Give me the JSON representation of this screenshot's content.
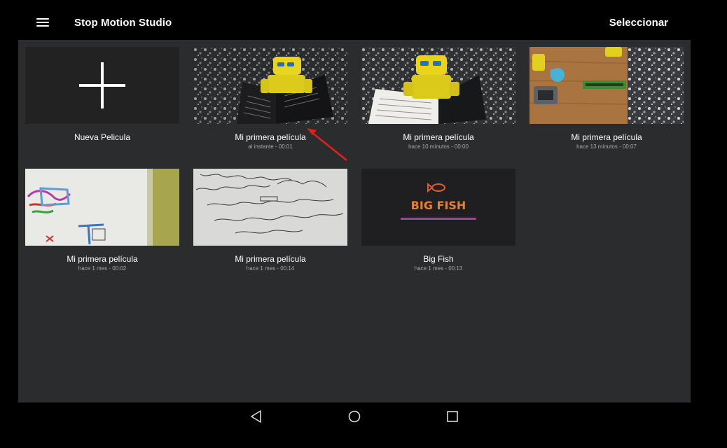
{
  "app_bar": {
    "title": "Stop Motion Studio",
    "select_label": "Seleccionar",
    "menu_icon": "hamburger-menu-icon"
  },
  "new_movie": {
    "label": "Nueva Pelicula",
    "icon": "plus-icon"
  },
  "movies": [
    {
      "title": "Mi primera película",
      "meta": "al instante - 00:01",
      "thumb": "yellow robot reading book"
    },
    {
      "title": "Mi primera película",
      "meta": "hace 10 minutos - 00:00",
      "thumb": "yellow robot reading book"
    },
    {
      "title": "Mi primera película",
      "meta": "hace 13 minutos - 00:07",
      "thumb": "toys on wooden table"
    },
    {
      "title": "Mi primera película",
      "meta": "hace 1 mes - 00:02",
      "thumb": "child drawing"
    },
    {
      "title": "Mi primera película",
      "meta": "hace 1 mes - 00:14",
      "thumb": "pencil sketch of clouds"
    },
    {
      "title": "Big Fish",
      "meta": "hace 1 mes - 00:13",
      "thumb": "big fish title card"
    }
  ],
  "thumb_text": {
    "big_fish_title": "BIG FISH"
  },
  "nav_bar": {
    "back_icon": "back-triangle-icon",
    "home_icon": "home-circle-icon",
    "recents_icon": "recents-square-icon"
  },
  "colors": {
    "background": "#000000",
    "content": "#2b2c2e",
    "tile": "#222222",
    "title_text": "#ffffff",
    "meta_text": "#a7a8aa",
    "annotation_arrow": "#e0201b"
  }
}
